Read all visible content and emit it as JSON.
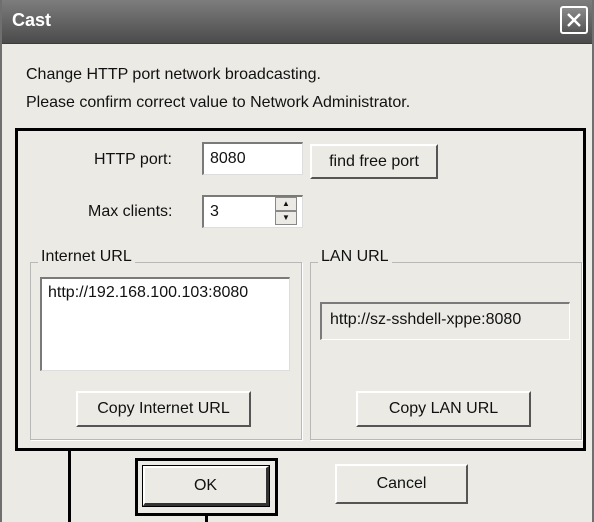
{
  "window": {
    "title": "Cast"
  },
  "messages": {
    "line1": "Change HTTP port network broadcasting.",
    "line2": "Please confirm correct value to Network Administrator."
  },
  "http_port": {
    "label": "HTTP port:",
    "value": "8080",
    "find_button": "find free port"
  },
  "max_clients": {
    "label": "Max clients:",
    "value": "3"
  },
  "internet": {
    "group_label": "Internet URL",
    "url": "http://192.168.100.103:8080",
    "copy_button": "Copy Internet URL"
  },
  "lan": {
    "group_label": "LAN URL",
    "url": "http://sz-sshdell-xppe:8080",
    "copy_button": "Copy LAN URL"
  },
  "footer": {
    "ok": "OK",
    "cancel": "Cancel"
  }
}
